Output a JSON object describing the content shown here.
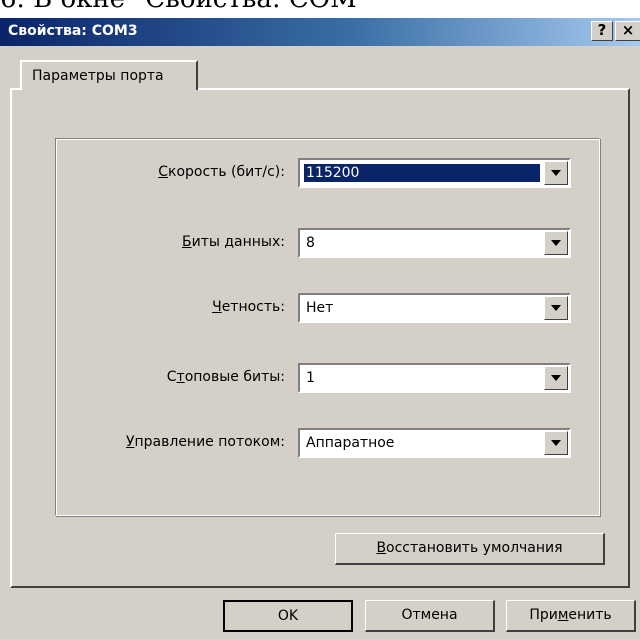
{
  "background_doc_text": "6.  В окне \"Свойства: COM",
  "window": {
    "title": "Свойства: COM3",
    "help_label": "?",
    "close_label": "×"
  },
  "tab": {
    "label": "Параметры порта"
  },
  "fields": [
    {
      "label_prefix": "",
      "label_mnemonic": "С",
      "label_rest": "корость (бит/с):",
      "value": "115200",
      "selected": true
    },
    {
      "label_prefix": "",
      "label_mnemonic": "Б",
      "label_rest": "иты данных:",
      "value": "8",
      "selected": false
    },
    {
      "label_prefix": "",
      "label_mnemonic": "Ч",
      "label_rest": "етность:",
      "value": "Нет",
      "selected": false
    },
    {
      "label_prefix": "С",
      "label_mnemonic": "т",
      "label_rest": "оповые биты:",
      "value": "1",
      "selected": false
    },
    {
      "label_prefix": "",
      "label_mnemonic": "У",
      "label_rest": "правление потоком:",
      "value": "Аппаратное",
      "selected": false
    }
  ],
  "buttons": {
    "restore_mnemonic": "В",
    "restore_rest": "осстановить умолчания",
    "ok": "OK",
    "cancel": "Отмена",
    "apply_prefix": "При",
    "apply_mnemonic": "м",
    "apply_rest": "енить"
  }
}
